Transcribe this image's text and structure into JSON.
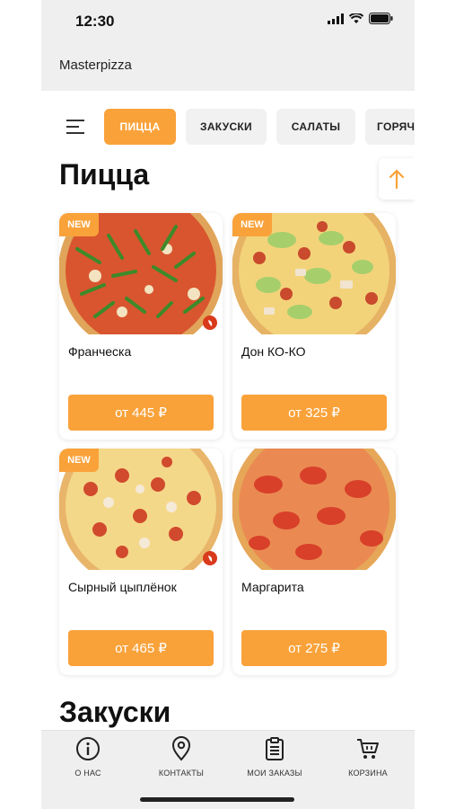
{
  "status": {
    "time": "12:30"
  },
  "app": {
    "title": "Masterpizza"
  },
  "categories": [
    {
      "label": "ПИЦЦА",
      "active": true
    },
    {
      "label": "ЗАКУСКИ",
      "active": false
    },
    {
      "label": "САЛАТЫ",
      "active": false
    },
    {
      "label": "ГОРЯЧ",
      "active": false
    }
  ],
  "sections": {
    "pizza_title": "Пицца",
    "snacks_title": "Закуски"
  },
  "products": [
    {
      "name": "Франческа",
      "price": "от 445 ₽",
      "badge": "NEW",
      "spicy": true,
      "image": "pizza-arugula"
    },
    {
      "name": "Дон КО-КО",
      "price": "от 325 ₽",
      "badge": "NEW",
      "spicy": false,
      "image": "pizza-caesar"
    },
    {
      "name": "Сырный цыплёнок",
      "price": "от 465 ₽",
      "badge": "NEW",
      "spicy": true,
      "image": "pizza-cheese-chicken"
    },
    {
      "name": "Маргарита",
      "price": "от 275 ₽",
      "badge": "",
      "spicy": false,
      "image": "pizza-margherita"
    }
  ],
  "tabs": [
    {
      "label": "О НАС",
      "icon": "info-icon"
    },
    {
      "label": "КОНТАКТЫ",
      "icon": "location-pin-icon"
    },
    {
      "label": "МОИ ЗАКАЗЫ",
      "icon": "clipboard-icon"
    },
    {
      "label": "КОРЗИНА",
      "icon": "cart-icon"
    }
  ],
  "colors": {
    "accent": "#f9a23a",
    "spicy": "#d93a1c",
    "bar_bg": "#efefef"
  }
}
